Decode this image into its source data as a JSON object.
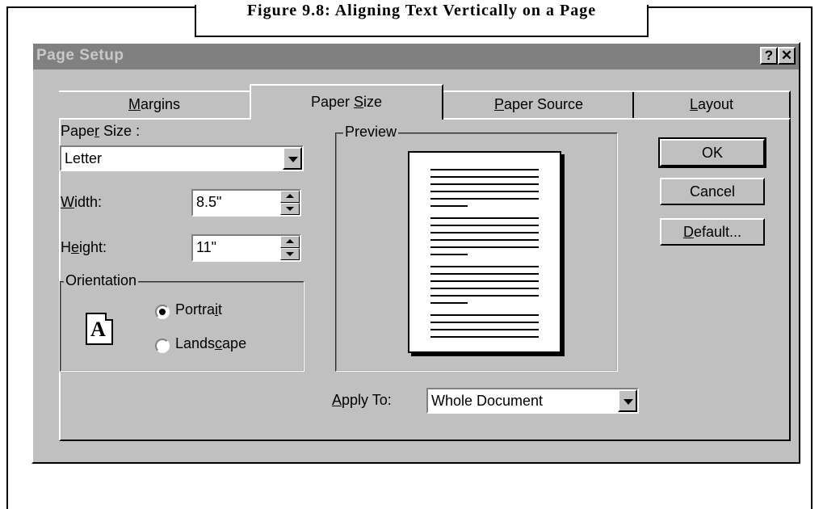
{
  "figure": {
    "caption": "Figure 9.8: Aligning Text Vertically on a Page"
  },
  "window": {
    "title": "Page Setup",
    "help_label": "?",
    "close_label": "✕"
  },
  "tabs": [
    {
      "label_pre": "",
      "label_key": "M",
      "label_post": "argins"
    },
    {
      "label_pre": "Paper ",
      "label_key": "S",
      "label_post": "ize"
    },
    {
      "label_pre": "",
      "label_key": "P",
      "label_post": "aper Source"
    },
    {
      "label_pre": "",
      "label_key": "L",
      "label_post": "ayout"
    }
  ],
  "paper_size": {
    "label_pre": "Pape",
    "label_key": "r",
    "label_post": " Size :",
    "value": "Letter"
  },
  "width": {
    "label_pre": "",
    "label_key": "W",
    "label_post": "idth:",
    "value": "8.5\""
  },
  "height": {
    "label_pre": "H",
    "label_key": "e",
    "label_post": "ight:",
    "value": "11\""
  },
  "orientation": {
    "title": "Orientation",
    "icon_letter": "A",
    "portrait": {
      "label_pre": "Portra",
      "label_key": "i",
      "label_post": "t",
      "selected": true
    },
    "landscape": {
      "label_pre": "Lands",
      "label_key": "c",
      "label_post": "ape",
      "selected": false
    }
  },
  "preview": {
    "title": "Preview"
  },
  "apply_to": {
    "label_pre": "",
    "label_key": "A",
    "label_post": "pply To:",
    "value": "Whole Document"
  },
  "buttons": {
    "ok": "OK",
    "cancel": "Cancel",
    "default": {
      "label_pre": "",
      "label_key": "D",
      "label_post": "efault..."
    }
  }
}
